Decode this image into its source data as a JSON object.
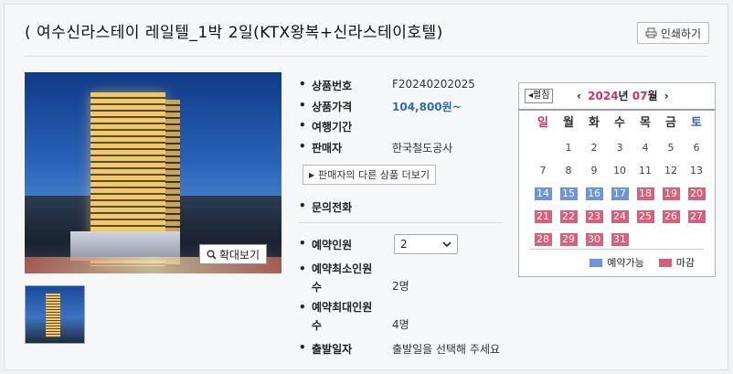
{
  "title": "( 여수신라스테이 레일텔_1박 2일(KTX왕복+신라스테이호텔)",
  "print_label": "인쇄하기",
  "zoom_label": "확대보기",
  "info": {
    "product_no_label": "상품번호",
    "product_no": "F20240202025",
    "price_label": "상품가격",
    "price": "104,800원~",
    "period_label": "여행기간",
    "period": "",
    "seller_label": "판매자",
    "seller": "한국철도공사",
    "more_btn": "판매자의 다른 상품 더보기",
    "phone_label": "문의전화",
    "phone": "",
    "people_label": "예약인원",
    "people_value": "2",
    "min_label_1": "예약최소인원",
    "min_label_2": "수",
    "min_value": "2명",
    "max_label_1": "예약최대인원",
    "max_label_2": "수",
    "max_value": "4명",
    "depart_label": "출발일자",
    "depart_value": "출발일을 선택해 주세요"
  },
  "calendar": {
    "fold_label": "◂펼침",
    "prev": "‹",
    "next": "›",
    "year": "2024",
    "year_suffix": "년",
    "month": "07",
    "month_suffix": "월",
    "dows": [
      "일",
      "월",
      "화",
      "수",
      "목",
      "금",
      "토"
    ],
    "dow_colors": [
      "#c8336a",
      "#333",
      "#333",
      "#333",
      "#333",
      "#333",
      "#2f62b8"
    ],
    "leading_blanks": 1,
    "days": [
      {
        "d": "1",
        "s": ""
      },
      {
        "d": "2",
        "s": ""
      },
      {
        "d": "3",
        "s": ""
      },
      {
        "d": "4",
        "s": ""
      },
      {
        "d": "5",
        "s": ""
      },
      {
        "d": "6",
        "s": ""
      },
      {
        "d": "7",
        "s": ""
      },
      {
        "d": "8",
        "s": ""
      },
      {
        "d": "9",
        "s": ""
      },
      {
        "d": "10",
        "s": ""
      },
      {
        "d": "11",
        "s": ""
      },
      {
        "d": "12",
        "s": ""
      },
      {
        "d": "13",
        "s": ""
      },
      {
        "d": "14",
        "s": "avail"
      },
      {
        "d": "15",
        "s": "avail"
      },
      {
        "d": "16",
        "s": "avail"
      },
      {
        "d": "17",
        "s": "avail"
      },
      {
        "d": "18",
        "s": "closed"
      },
      {
        "d": "19",
        "s": "closed"
      },
      {
        "d": "20",
        "s": "closed"
      },
      {
        "d": "21",
        "s": "closed"
      },
      {
        "d": "22",
        "s": "closed"
      },
      {
        "d": "23",
        "s": "closed"
      },
      {
        "d": "24",
        "s": "closed"
      },
      {
        "d": "25",
        "s": "closed"
      },
      {
        "d": "26",
        "s": "closed"
      },
      {
        "d": "27",
        "s": "closed"
      },
      {
        "d": "28",
        "s": "closed"
      },
      {
        "d": "29",
        "s": "closed"
      },
      {
        "d": "30",
        "s": "closed"
      },
      {
        "d": "31",
        "s": "closed"
      }
    ],
    "legend_avail": "예약가능",
    "legend_closed": "마감",
    "color_avail": "#6c93dd",
    "color_closed": "#d9607a"
  }
}
